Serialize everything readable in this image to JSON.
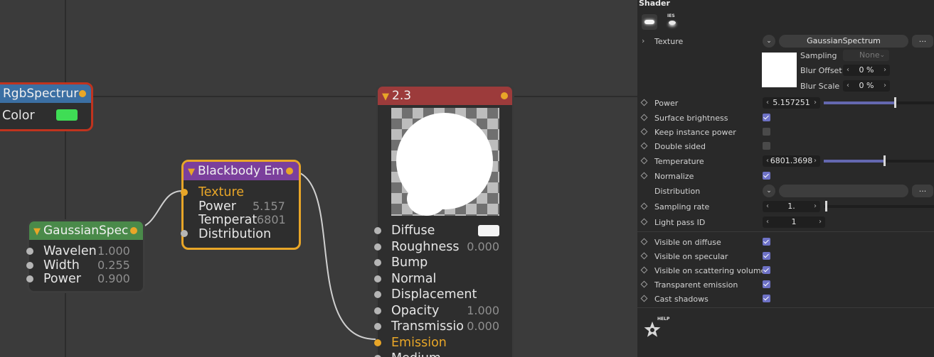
{
  "nodes": {
    "rgb": {
      "title": "RgbSpectrur",
      "color_label": "Color",
      "swatch": "#3fdd55",
      "head_color": "#3b6fa3",
      "border": "#c0331e"
    },
    "blackbody": {
      "title": "Blackbody Em",
      "head_color": "#7b3f9c",
      "border": "#e8a628",
      "params": [
        {
          "label": "Texture",
          "value": ""
        },
        {
          "label": "Power",
          "value": "5.157"
        },
        {
          "label": "Temperat",
          "value": "6801"
        },
        {
          "label": "Distribution",
          "value": ""
        }
      ]
    },
    "gaussian": {
      "title": "GaussianSpec",
      "head_color": "#4a8a4a",
      "params": [
        {
          "label": "Wavelen",
          "value": "1.000"
        },
        {
          "label": "Width",
          "value": "0.255"
        },
        {
          "label": "Power",
          "value": "0.900"
        }
      ]
    },
    "material": {
      "title": "2.3",
      "head_color": "#9c3b3b",
      "params": [
        {
          "label": "Diffuse",
          "value": ""
        },
        {
          "label": "Roughness",
          "value": "0.000"
        },
        {
          "label": "Bump",
          "value": ""
        },
        {
          "label": "Normal",
          "value": ""
        },
        {
          "label": "Displacement",
          "value": ""
        },
        {
          "label": "Opacity",
          "value": "1.000"
        },
        {
          "label": "Transmissio",
          "value": "0.000"
        },
        {
          "label": "Emission",
          "value": ""
        },
        {
          "label": "Medium",
          "value": ""
        }
      ]
    }
  },
  "panel": {
    "title": "Shader",
    "ies_label": "IES",
    "texture": {
      "label": "Texture",
      "value": "GaussianSpectrum",
      "more": "..."
    },
    "sampling": {
      "label": "Sampling",
      "value": "None"
    },
    "blur_offset": {
      "label": "Blur Offset",
      "value": "0 %"
    },
    "blur_scale": {
      "label": "Blur Scale",
      "value": "0 %"
    },
    "power": {
      "label": "Power",
      "value": "5.157251",
      "fraction": 0.64
    },
    "surface_brightness": {
      "label": "Surface brightness",
      "checked": true
    },
    "keep_instance_power": {
      "label": "Keep instance power",
      "checked": false
    },
    "double_sided": {
      "label": "Double sided",
      "checked": false
    },
    "temperature": {
      "label": "Temperature",
      "value": "6801.3698",
      "fraction": 0.54
    },
    "normalize": {
      "label": "Normalize",
      "checked": true
    },
    "distribution": {
      "label": "Distribution",
      "more": "..."
    },
    "sampling_rate": {
      "label": "Sampling rate",
      "value": "1."
    },
    "light_pass_id": {
      "label": "Light pass ID",
      "value": "1"
    },
    "visibility": [
      {
        "label": "Visible on diffuse",
        "checked": true
      },
      {
        "label": "Visible on specular",
        "checked": true
      },
      {
        "label": "Visible on scattering volumes",
        "checked": true
      },
      {
        "label": "Transparent emission",
        "checked": true
      },
      {
        "label": "Cast shadows",
        "checked": true
      }
    ],
    "help_label": "HELP"
  }
}
